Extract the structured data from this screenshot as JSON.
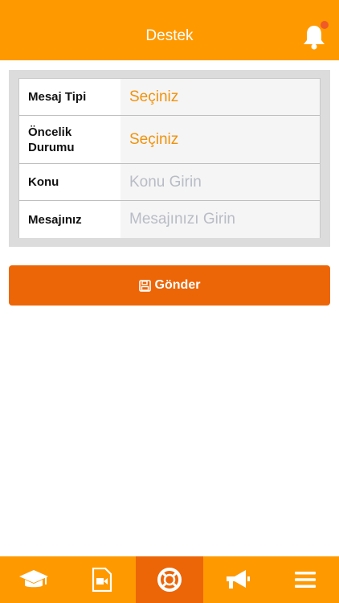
{
  "header": {
    "title": "Destek",
    "notification_icon": "bell-icon"
  },
  "form": {
    "rows": [
      {
        "label": "Mesaj Tipi",
        "value": "Seçiniz",
        "kind": "select"
      },
      {
        "label": "Öncelik Durumu",
        "value": "Seçiniz",
        "kind": "select"
      },
      {
        "label": "Konu",
        "placeholder": "Konu Girin",
        "kind": "input"
      },
      {
        "label": "Mesajınız",
        "placeholder": "Mesajınızı Girin",
        "kind": "input"
      }
    ]
  },
  "send_button": {
    "label": "Gönder",
    "icon": "floppy-disk-icon"
  },
  "tabbar": {
    "items": [
      {
        "icon": "graduation-cap-icon"
      },
      {
        "icon": "video-file-icon"
      },
      {
        "icon": "lifebuoy-icon",
        "active": true
      },
      {
        "icon": "megaphone-icon"
      },
      {
        "icon": "menu-icon"
      }
    ]
  },
  "colors": {
    "primary": "#ff9900",
    "accent": "#ec6608",
    "select_text": "#f0920a"
  }
}
